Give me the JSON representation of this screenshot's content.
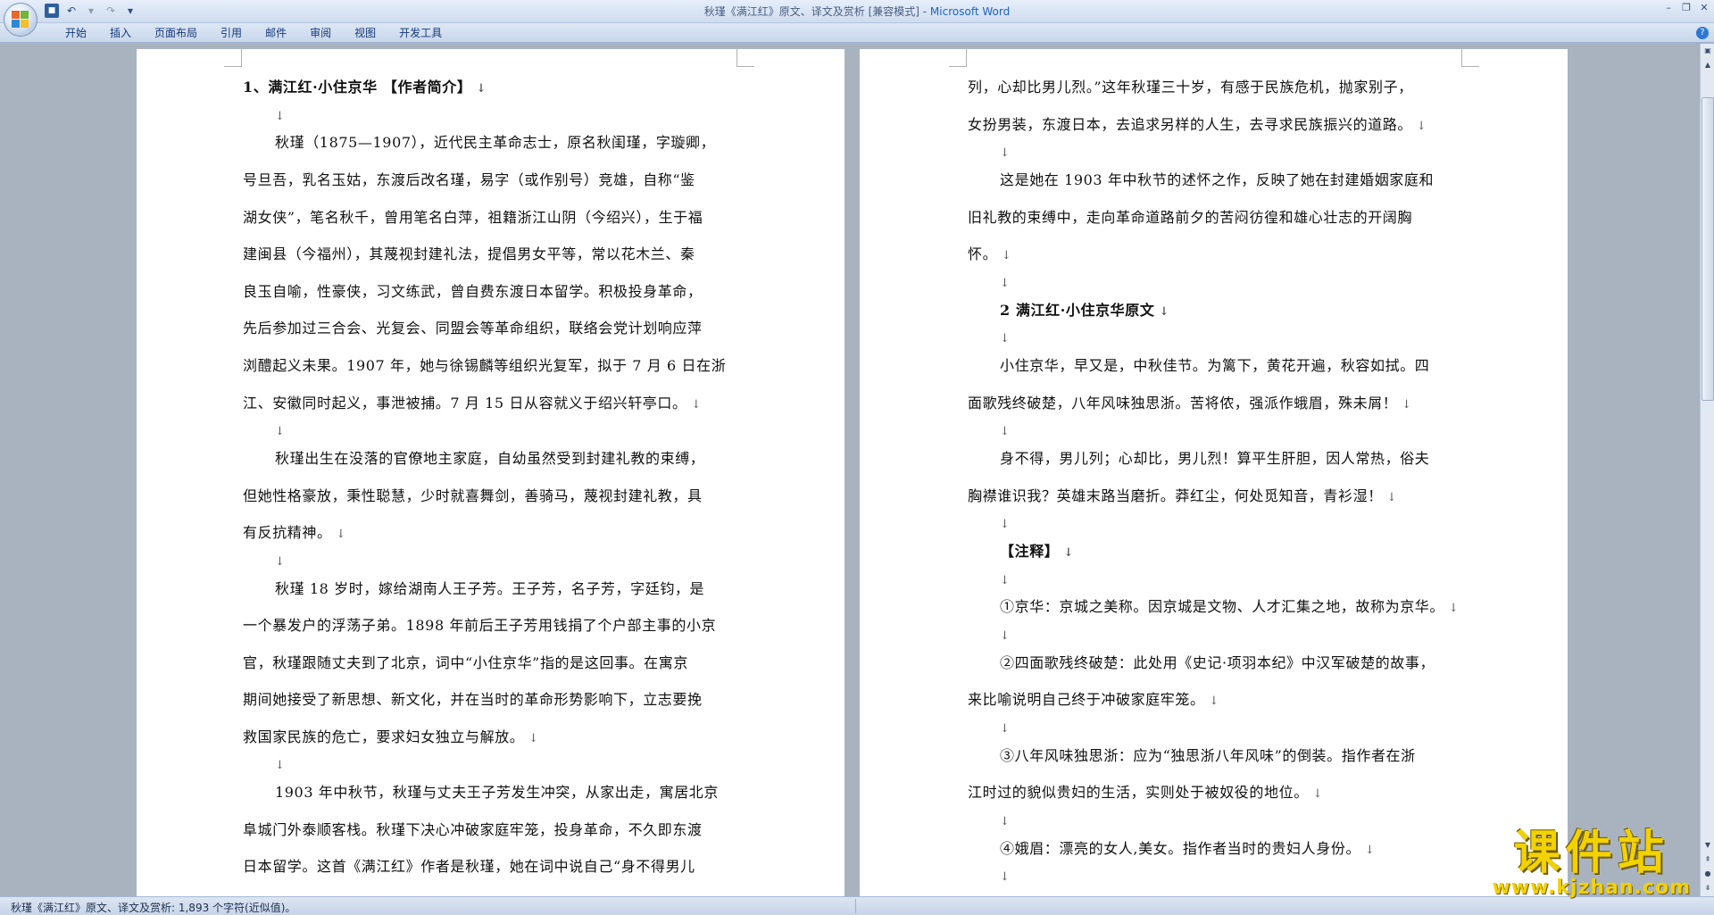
{
  "window": {
    "title_prefix": "秋瑾《满江红》原文、译文及赏析 [兼容模式] - ",
    "title_brand": "Microsoft Word"
  },
  "ribbon": {
    "tabs": [
      "开始",
      "插入",
      "页面布局",
      "引用",
      "邮件",
      "审阅",
      "视图",
      "开发工具"
    ]
  },
  "icons": {
    "office_button": "office-logo-icon",
    "save": "save-icon",
    "undo": "undo-icon",
    "redo": "redo-icon",
    "customize": "dropdown-arrow-icon",
    "help": "help-icon"
  },
  "marks": {
    "para": "↓"
  },
  "left_page": {
    "heading": "1、满江红·小住京华 【作者简介】",
    "p1": [
      "秋瑾（1875—1907），近代民主革命志士，原名秋闺瑾，字璇卿，",
      "号旦吾，乳名玉姑，东渡后改名瑾，易字（或作别号）竞雄，自称“鉴",
      "湖女侠”，笔名秋千，曾用笔名白萍，祖籍浙江山阴（今绍兴），生于福",
      "建闽县（今福州），其蔑视封建礼法，提倡男女平等，常以花木兰、秦",
      "良玉自喻，性豪侠，习文练武，曾自费东渡日本留学。积极投身革命，",
      "先后参加过三合会、光复会、同盟会等革命组织，联络会党计划响应萍",
      "浏醴起义未果。1907 年，她与徐锡麟等组织光复军，拟于 7 月 6 日在浙",
      "江、安徽同时起义，事泄被捕。7 月 15 日从容就义于绍兴轩亭口。"
    ],
    "p2": [
      "秋瑾出生在没落的官僚地主家庭，自幼虽然受到封建礼教的束缚，",
      "但她性格豪放，秉性聪慧，少时就喜舞剑，善骑马，蔑视封建礼教，具",
      "有反抗精神。"
    ],
    "p3": [
      "秋瑾 18 岁时，嫁给湖南人王子芳。王子芳，名子芳，字廷钧，是",
      "一个暴发户的浮荡子弟。1898 年前后王子芳用钱捐了个户部主事的小京",
      "官，秋瑾跟随丈夫到了北京，词中“小住京华”指的是这回事。在寓京",
      "期间她接受了新思想、新文化，并在当时的革命形势影响下，立志要挽",
      "救国家民族的危亡，要求妇女独立与解放。"
    ],
    "p4": [
      "1903 年中秋节，秋瑾与丈夫王子芳发生冲突，从家出走，寓居北京",
      "阜城门外泰顺客栈。秋瑾下决心冲破家庭牢笼，投身革命，不久即东渡",
      "日本留学。这首《满江红》作者是秋瑾，她在词中说自己“身不得男儿"
    ]
  },
  "right_page": {
    "p0": [
      "列，心却比男儿烈。”这年秋瑾三十岁，有感于民族危机，抛家别子，",
      "女扮男装，东渡日本，去追求另样的人生，去寻求民族振兴的道路。"
    ],
    "p1": [
      "这是她在 1903 年中秋节的述怀之作，反映了她在封建婚姻家庭和",
      "旧礼教的束缚中，走向革命道路前夕的苦闷彷徨和雄心壮志的开阔胸",
      "怀。"
    ],
    "heading2": "2 满江红·小住京华原文",
    "poem1": [
      "小住京华，早又是，中秋佳节。为篱下，黄花开遍，秋容如拭。四",
      "面歌残终破楚，八年风味独思浙。苦将侬，强派作蛾眉，殊未屑！"
    ],
    "poem2": [
      "身不得，男儿列；心却比，男儿烈！算平生肝胆，因人常热，俗夫",
      "胸襟谁识我？英雄末路当磨折。莽红尘，何处觅知音，青衫湿！"
    ],
    "notes_heading": "【注释】",
    "note1": [
      "①京华：京城之美称。因京城是文物、人才汇集之地，故称为京华。"
    ],
    "note2": [
      "②四面歌残终破楚：此处用《史记·项羽本纪》中汉军破楚的故事，",
      "来比喻说明自己终于冲破家庭牢笼。"
    ],
    "note3": [
      "③八年风味独思浙：应为“独思浙八年风味”的倒装。指作者在浙",
      "江时过的貌似贵妇的生活，实则处于被奴役的地位。"
    ],
    "note4": [
      "④娥眉：漂亮的女人,美女。指作者当时的贵妇人身份。"
    ]
  },
  "status": {
    "text": "秋瑾《满江红》原文、译文及赏析: 1,893 个字符(近似值)。"
  },
  "watermark": {
    "title": "课件站",
    "url": "www.kjzhan.com"
  }
}
